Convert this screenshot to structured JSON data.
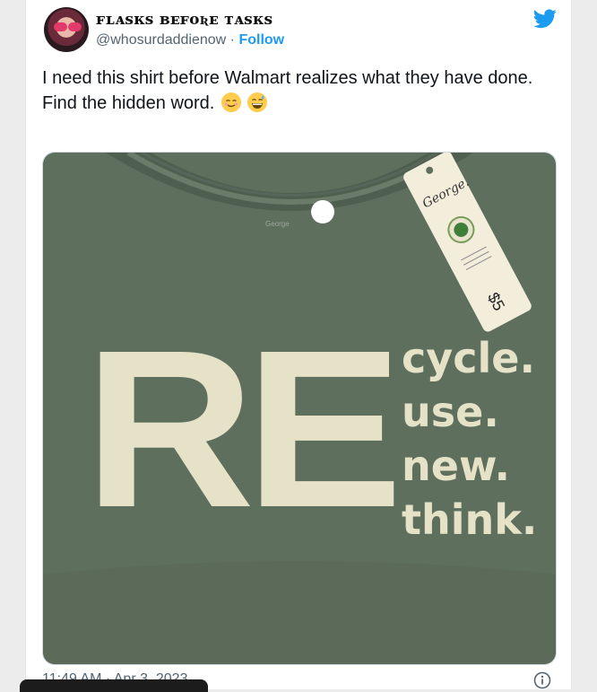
{
  "tweet": {
    "author_name": "ꜰʟᴀꜱᴋꜱ ʙᴇꜰᴏʀᴇ ᴛᴀꜱᴋꜱ",
    "handle": "@whosurdaddienow",
    "separator": "·",
    "follow_label": "Follow",
    "text_line1": "I need this shirt before Walmart realizes what they have done.",
    "text_line2": "Find the hidden word.",
    "emojis": [
      "relieved-face-emoji",
      "grinning-sweat-emoji"
    ],
    "timestamp": "11:49 AM · Apr 3, 2023"
  },
  "image": {
    "big_word": "RE",
    "words": [
      "cycle.",
      "use.",
      "new.",
      "think."
    ],
    "tag_brand": "George.",
    "tag_price": "$5",
    "colors": {
      "shirt": "#5e6e5d",
      "print": "#e7e3c9",
      "tag": "#f4efdf"
    }
  },
  "colors": {
    "accent": "#1d9bf0",
    "text": "#0f1419",
    "muted": "#536471"
  }
}
